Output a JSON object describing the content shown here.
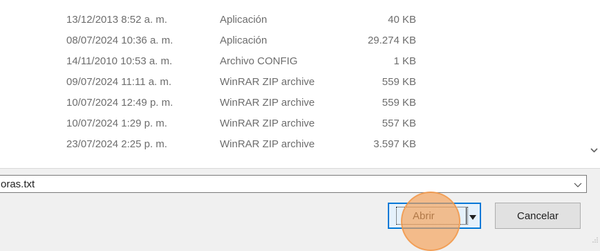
{
  "file_list": {
    "rows": [
      {
        "date": "13/12/2013 8:52 a. m.",
        "type": "Aplicación",
        "size": "40 KB"
      },
      {
        "date": "08/07/2024 10:36 a. m.",
        "type": "Aplicación",
        "size": "29.274 KB"
      },
      {
        "date": "14/11/2010 10:53 a. m.",
        "type": "Archivo CONFIG",
        "size": "1 KB"
      },
      {
        "date": "09/07/2024 11:11 a. m.",
        "type": "WinRAR ZIP archive",
        "size": "559 KB"
      },
      {
        "date": "10/07/2024 12:49 p. m.",
        "type": "WinRAR ZIP archive",
        "size": "559 KB"
      },
      {
        "date": "10/07/2024 1:29 p. m.",
        "type": "WinRAR ZIP archive",
        "size": "557 KB"
      },
      {
        "date": "23/07/2024 2:25 p. m.",
        "type": "WinRAR ZIP archive",
        "size": "3.597 KB"
      }
    ]
  },
  "filename_field": {
    "value": "oras.txt"
  },
  "buttons": {
    "open_label": "Abrir",
    "cancel_label": "Cancelar"
  },
  "icons": {
    "scroll_down": "chevron-down-icon",
    "filename_dropdown": "chevron-down-icon",
    "open_split_arrow": "caret-down-icon"
  },
  "colors": {
    "accent": "#0078d7",
    "click_highlight": "#f5a25a"
  }
}
